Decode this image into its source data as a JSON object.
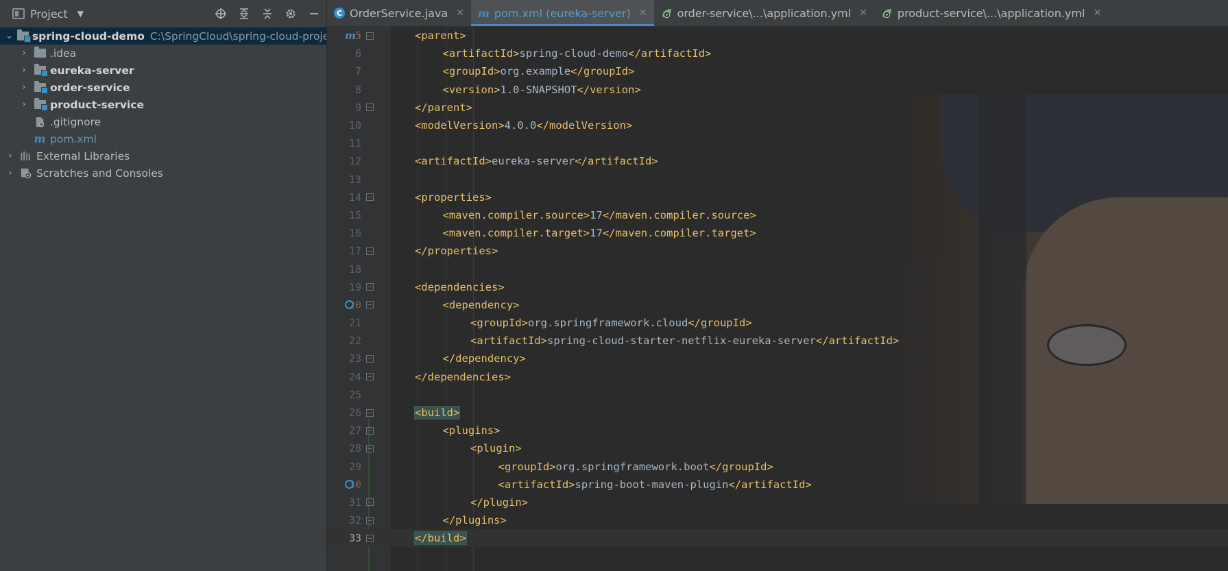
{
  "project_panel": {
    "title": "Project",
    "root": {
      "name": "spring-cloud-demo",
      "path": "C:\\SpringCloud\\spring-cloud-project"
    },
    "items": [
      {
        "label": ".idea",
        "kind": "folder",
        "bold": false
      },
      {
        "label": "eureka-server",
        "kind": "module",
        "bold": true
      },
      {
        "label": "order-service",
        "kind": "module",
        "bold": true
      },
      {
        "label": "product-service",
        "kind": "module",
        "bold": true
      },
      {
        "label": ".gitignore",
        "kind": "file"
      },
      {
        "label": "pom.xml",
        "kind": "maven"
      }
    ],
    "external_libraries": "External Libraries",
    "scratches": "Scratches and Consoles"
  },
  "tabs": [
    {
      "label": "OrderService.java",
      "icon": "class-icon",
      "active": false
    },
    {
      "label": "pom.xml (eureka-server)",
      "icon": "maven-icon",
      "active": true
    },
    {
      "label": "order-service\\...\\application.yml",
      "icon": "spring-config-icon",
      "active": false
    },
    {
      "label": "product-service\\...\\application.yml",
      "icon": "spring-config-icon",
      "active": false
    }
  ],
  "editor": {
    "lines": [
      {
        "n": "5",
        "indent": 1,
        "open": "<parent>",
        "text": "",
        "close": ""
      },
      {
        "n": "6",
        "indent": 2,
        "open": "<artifactId>",
        "text": "spring-cloud-demo",
        "close": "</artifactId>"
      },
      {
        "n": "7",
        "indent": 2,
        "open": "<groupId>",
        "text": "org.example",
        "close": "</groupId>"
      },
      {
        "n": "8",
        "indent": 2,
        "open": "<version>",
        "text": "1.0-SNAPSHOT",
        "close": "</version>"
      },
      {
        "n": "9",
        "indent": 1,
        "open": "</parent>",
        "text": "",
        "close": ""
      },
      {
        "n": "10",
        "indent": 1,
        "open": "<modelVersion>",
        "text": "4.0.0",
        "close": "</modelVersion>"
      },
      {
        "n": "11",
        "indent": 0,
        "open": "",
        "text": "",
        "close": ""
      },
      {
        "n": "12",
        "indent": 1,
        "open": "<artifactId>",
        "text": "eureka-server",
        "close": "</artifactId>"
      },
      {
        "n": "13",
        "indent": 0,
        "open": "",
        "text": "",
        "close": ""
      },
      {
        "n": "14",
        "indent": 1,
        "open": "<properties>",
        "text": "",
        "close": ""
      },
      {
        "n": "15",
        "indent": 2,
        "open": "<maven.compiler.source>",
        "text": "17",
        "close": "</maven.compiler.source>"
      },
      {
        "n": "16",
        "indent": 2,
        "open": "<maven.compiler.target>",
        "text": "17",
        "close": "</maven.compiler.target>"
      },
      {
        "n": "17",
        "indent": 1,
        "open": "</properties>",
        "text": "",
        "close": ""
      },
      {
        "n": "18",
        "indent": 0,
        "open": "",
        "text": "",
        "close": ""
      },
      {
        "n": "19",
        "indent": 1,
        "open": "<dependencies>",
        "text": "",
        "close": ""
      },
      {
        "n": "20",
        "indent": 2,
        "open": "<dependency>",
        "text": "",
        "close": ""
      },
      {
        "n": "21",
        "indent": 3,
        "open": "<groupId>",
        "text": "org.springframework.cloud",
        "close": "</groupId>"
      },
      {
        "n": "22",
        "indent": 3,
        "open": "<artifactId>",
        "text": "spring-cloud-starter-netflix-eureka-server",
        "close": "</artifactId>"
      },
      {
        "n": "23",
        "indent": 2,
        "open": "</dependency>",
        "text": "",
        "close": ""
      },
      {
        "n": "24",
        "indent": 1,
        "open": "</dependencies>",
        "text": "",
        "close": ""
      },
      {
        "n": "25",
        "indent": 0,
        "open": "",
        "text": "",
        "close": ""
      },
      {
        "n": "26",
        "indent": 1,
        "open": "<build>",
        "text": "",
        "close": ""
      },
      {
        "n": "27",
        "indent": 2,
        "open": "<plugins>",
        "text": "",
        "close": ""
      },
      {
        "n": "28",
        "indent": 3,
        "open": "<plugin>",
        "text": "",
        "close": ""
      },
      {
        "n": "29",
        "indent": 4,
        "open": "<groupId>",
        "text": "org.springframework.boot",
        "close": "</groupId>"
      },
      {
        "n": "30",
        "indent": 4,
        "open": "<artifactId>",
        "text": "spring-boot-maven-plugin",
        "close": "</artifactId>"
      },
      {
        "n": "31",
        "indent": 3,
        "open": "</plugin>",
        "text": "",
        "close": ""
      },
      {
        "n": "32",
        "indent": 2,
        "open": "</plugins>",
        "text": "",
        "close": ""
      },
      {
        "n": "33",
        "indent": 1,
        "open": "</build>",
        "text": "",
        "close": ""
      }
    ],
    "caret_line": "33",
    "highlighted_lines": [
      "26",
      "33"
    ],
    "fold_lines": [
      "5",
      "9",
      "14",
      "17",
      "19",
      "20",
      "23",
      "24",
      "26",
      "27",
      "28",
      "31",
      "32",
      "33"
    ],
    "gutter_marks": {
      "5": "maven-parent-icon",
      "20": "override-icon",
      "30": "override-icon"
    }
  },
  "colors": {
    "tag": "#e8bf6a",
    "text": "#a9b7c6",
    "line_number": "#606366",
    "active_tab_text": "#5d9bc6",
    "selection": "#0d293e"
  }
}
